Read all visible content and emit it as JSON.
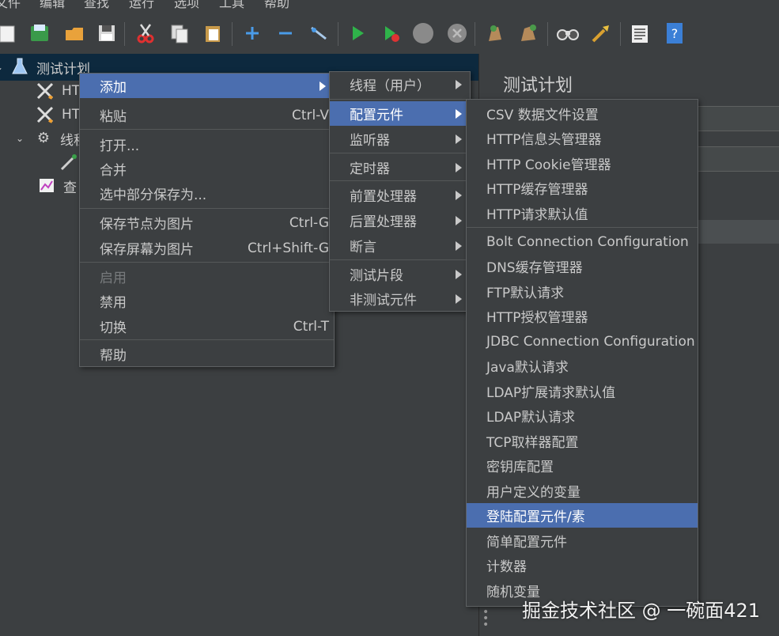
{
  "menubar": [
    "文件",
    "编辑",
    "查找",
    "运行",
    "选项",
    "工具",
    "帮助"
  ],
  "tree": {
    "items": [
      {
        "label": "测试计划",
        "icon": "flask-icon"
      },
      {
        "label": "HT",
        "icon": "wrench-icon"
      },
      {
        "label": "HT",
        "icon": "wrench-icon"
      },
      {
        "label": "线程",
        "icon": "gear-icon"
      },
      {
        "label": "",
        "icon": "pipette-icon"
      },
      {
        "label": "查",
        "icon": "graph-icon"
      }
    ]
  },
  "right_panel": {
    "title": "测试计划"
  },
  "context_menu": {
    "items": [
      {
        "label": "添加",
        "shortcut": "",
        "submenu": true,
        "selected": true,
        "disabled": false
      },
      {
        "label": "粘贴",
        "shortcut": "Ctrl-V",
        "submenu": false,
        "selected": false,
        "disabled": false
      },
      {
        "label": "打开...",
        "shortcut": "",
        "submenu": false,
        "selected": false,
        "disabled": false
      },
      {
        "label": "合并",
        "shortcut": "",
        "submenu": false,
        "selected": false,
        "disabled": false
      },
      {
        "label": "选中部分保存为...",
        "shortcut": "",
        "submenu": false,
        "selected": false,
        "disabled": false
      },
      {
        "label": "保存节点为图片",
        "shortcut": "Ctrl-G",
        "submenu": false,
        "selected": false,
        "disabled": false
      },
      {
        "label": "保存屏幕为图片",
        "shortcut": "Ctrl+Shift-G",
        "submenu": false,
        "selected": false,
        "disabled": false
      },
      {
        "label": "启用",
        "shortcut": "",
        "submenu": false,
        "selected": false,
        "disabled": true
      },
      {
        "label": "禁用",
        "shortcut": "",
        "submenu": false,
        "selected": false,
        "disabled": false
      },
      {
        "label": "切换",
        "shortcut": "Ctrl-T",
        "submenu": false,
        "selected": false,
        "disabled": false
      },
      {
        "label": "帮助",
        "shortcut": "",
        "submenu": false,
        "selected": false,
        "disabled": false
      }
    ]
  },
  "add_submenu": {
    "items": [
      {
        "label": "线程（用户）",
        "selected": false
      },
      {
        "label": "配置元件",
        "selected": true
      },
      {
        "label": "监听器",
        "selected": false
      },
      {
        "label": "定时器",
        "selected": false
      },
      {
        "label": "前置处理器",
        "selected": false
      },
      {
        "label": "后置处理器",
        "selected": false
      },
      {
        "label": "断言",
        "selected": false
      },
      {
        "label": "测试片段",
        "selected": false
      },
      {
        "label": "非测试元件",
        "selected": false
      }
    ]
  },
  "config_submenu": {
    "items": [
      {
        "label": "CSV 数据文件设置",
        "selected": false
      },
      {
        "label": "HTTP信息头管理器",
        "selected": false
      },
      {
        "label": "HTTP Cookie管理器",
        "selected": false
      },
      {
        "label": "HTTP缓存管理器",
        "selected": false
      },
      {
        "label": "HTTP请求默认值",
        "selected": false
      },
      {
        "label": "Bolt Connection Configuration",
        "selected": false
      },
      {
        "label": "DNS缓存管理器",
        "selected": false
      },
      {
        "label": "FTP默认请求",
        "selected": false
      },
      {
        "label": "HTTP授权管理器",
        "selected": false
      },
      {
        "label": "JDBC Connection Configuration",
        "selected": false
      },
      {
        "label": "Java默认请求",
        "selected": false
      },
      {
        "label": "LDAP扩展请求默认值",
        "selected": false
      },
      {
        "label": "LDAP默认请求",
        "selected": false
      },
      {
        "label": "TCP取样器配置",
        "selected": false
      },
      {
        "label": "密钥库配置",
        "selected": false
      },
      {
        "label": "用户定义的变量",
        "selected": false
      },
      {
        "label": "登陆配置元件/素",
        "selected": true
      },
      {
        "label": "简单配置元件",
        "selected": false
      },
      {
        "label": "计数器",
        "selected": false
      },
      {
        "label": "随机变量",
        "selected": false
      }
    ]
  },
  "watermark": "掘金技术社区 @ 一碗面421",
  "colors": {
    "highlight": "#4b6eaf",
    "background": "#3c3f41",
    "tree_selection": "#0d293e"
  }
}
